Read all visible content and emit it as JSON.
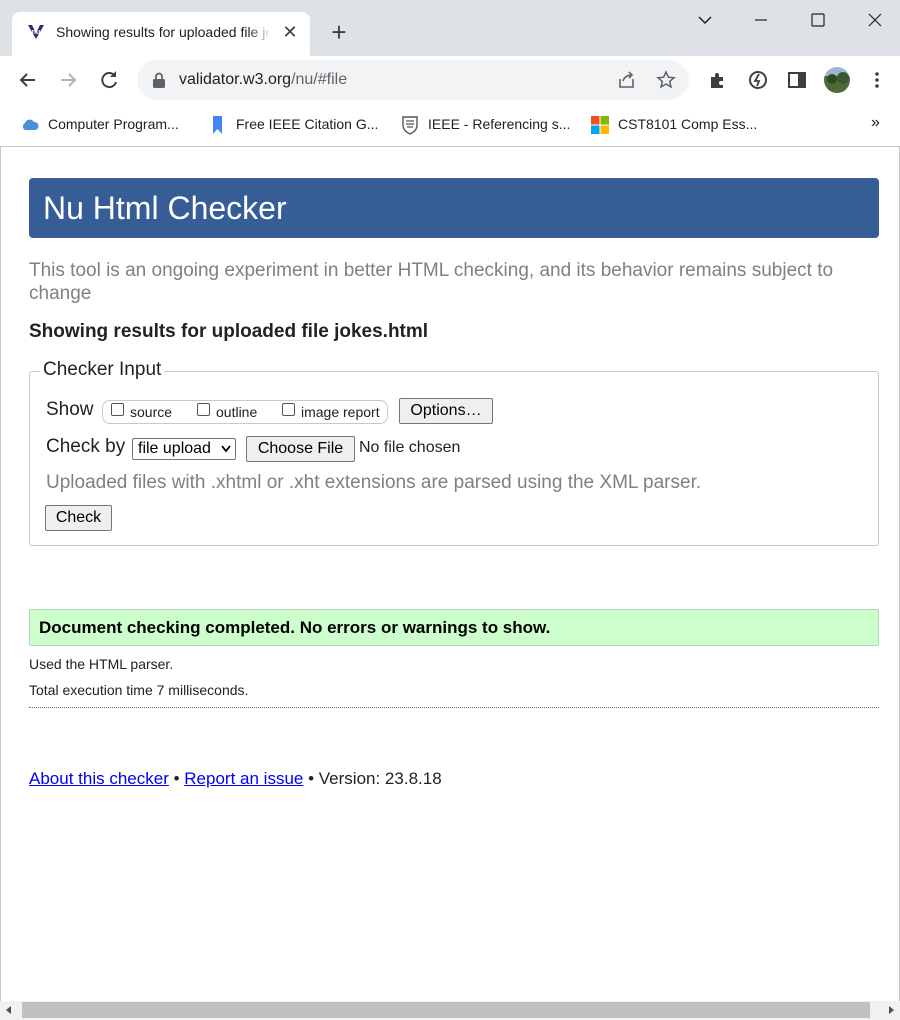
{
  "browser": {
    "tab": {
      "title": "Showing results for uploaded file jokes.html"
    },
    "omnibox": {
      "url_host": "validator.w3.org",
      "url_path": "/nu/#file"
    },
    "bookmarks": [
      {
        "label": "Computer Program...",
        "icon": "cloud-icon",
        "color": "#4a90d9"
      },
      {
        "label": "Free IEEE Citation G...",
        "icon": "bookmark-ribbon-icon",
        "color": "#4285f4"
      },
      {
        "label": "IEEE - Referencing s...",
        "icon": "shield-crest-icon",
        "color": "#555555"
      },
      {
        "label": "CST8101 Comp Ess...",
        "icon": "microsoft-logo-icon",
        "color": "#f25022"
      }
    ],
    "bookmarks_overflow": "»"
  },
  "page": {
    "banner_title": "Nu Html Checker",
    "intro": "This tool is an ongoing experiment in better HTML checking, and its behavior remains subject to change",
    "results_heading": "Showing results for uploaded file jokes.html",
    "checker_input": {
      "legend": "Checker Input",
      "show_label": "Show",
      "show_options": [
        "source",
        "outline",
        "image report"
      ],
      "options_button": "Options…",
      "check_by_label": "Check by",
      "check_by_value": "file upload",
      "choose_file_button": "Choose File",
      "no_file_text": "No file chosen",
      "xml_note": "Uploaded files with .xhtml or .xht extensions are parsed using the XML parser.",
      "check_button": "Check"
    },
    "success_message": "Document checking completed. No errors or warnings to show.",
    "parser_info": "Used the HTML parser.",
    "execution_time": "Total execution time 7 milliseconds.",
    "footer": {
      "about_link": "About this checker",
      "sep": "•",
      "report_link": "Report an issue",
      "version": "Version: 23.8.18"
    }
  },
  "colors": {
    "banner": "#365d95",
    "success_bg": "#ccffcc",
    "link": "#0000ee"
  }
}
